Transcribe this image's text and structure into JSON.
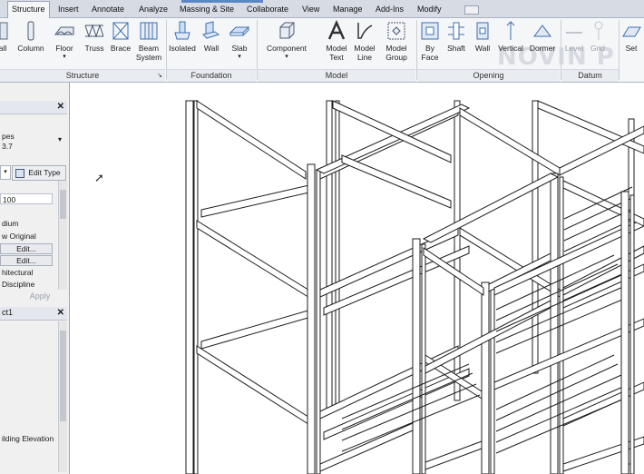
{
  "ribbon": {
    "tabs": [
      "Structure",
      "Insert",
      "Annotate",
      "Analyze",
      "Massing & Site",
      "Collaborate",
      "View",
      "Manage",
      "Add-Ins",
      "Modify"
    ],
    "active_tab": "Structure",
    "buttons": {
      "wall_partial": "all",
      "column": "Column",
      "floor": "Floor",
      "truss": "Truss",
      "brace": "Brace",
      "beam_system_1": "Beam",
      "beam_system_2": "System",
      "isolated": "Isolated",
      "wall": "Wall",
      "slab": "Slab",
      "component": "Component",
      "model_text_1": "Model",
      "model_text_2": "Text",
      "model_line_1": "Model",
      "model_line_2": "Line",
      "model_group_1": "Model",
      "model_group_2": "Group",
      "by_face_1": "By",
      "by_face_2": "Face",
      "shaft": "Shaft",
      "opening_wall": "Wall",
      "vertical": "Vertical",
      "dormer": "Dormer",
      "level": "Level",
      "grid": "Grid",
      "set": "Set"
    },
    "panels": {
      "structure": "Structure",
      "foundation": "Foundation",
      "model": "Model",
      "opening": "Opening",
      "datum": "Datum"
    },
    "watermark": "NOVIN P"
  },
  "properties": {
    "type_line1": "pes",
    "type_line2": "3.7",
    "edit_type": "Edit Type",
    "scale_value": "100",
    "rows": [
      "dium",
      "w Original",
      "Edit...",
      "Edit...",
      "hitectural",
      "Discipline"
    ],
    "apply": "Apply"
  },
  "browser": {
    "title": "ct1",
    "item": "ilding Elevation"
  }
}
